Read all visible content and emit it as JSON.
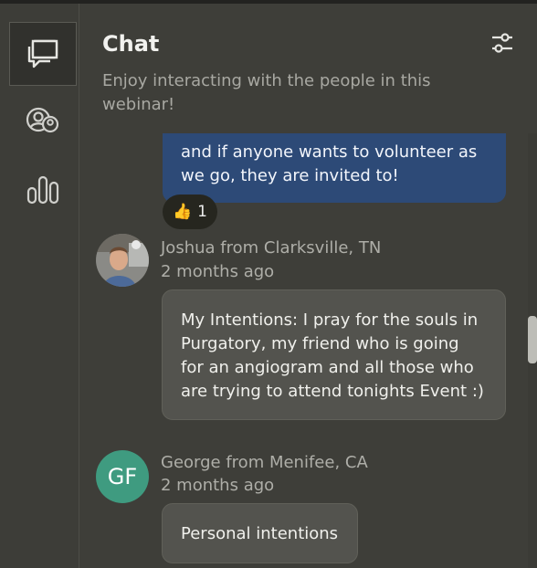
{
  "rail": {
    "items": [
      {
        "name": "chat",
        "icon": "chat-icon"
      },
      {
        "name": "people",
        "icon": "people-icon"
      },
      {
        "name": "polls",
        "icon": "bar-chart-icon"
      }
    ]
  },
  "header": {
    "title": "Chat",
    "subtitle": "Enjoy interacting with the people in this webinar!",
    "settings_icon": "sliders-icon"
  },
  "messages": [
    {
      "author": "",
      "time": "",
      "lines": [
        "and if anyone wants to volunteer as",
        "we go, they are invited to!"
      ],
      "reaction": {
        "emoji": "👍",
        "count": "1"
      },
      "bubble_color": "#2d4a77"
    },
    {
      "author": "Joshua from Clarksville, TN",
      "time": "2 months ago",
      "lines": [
        "My Intentions: I pray for the souls in",
        "Purgatory, my friend who is going",
        "for an angiogram and all those who",
        "are trying to attend tonights Event :)"
      ],
      "avatar": "photo"
    },
    {
      "author": "George from Menifee, CA",
      "time": "2 months ago",
      "lines": [
        "Personal intentions"
      ],
      "avatar_initials": "GF",
      "avatar_color": "#3f9b80"
    }
  ]
}
